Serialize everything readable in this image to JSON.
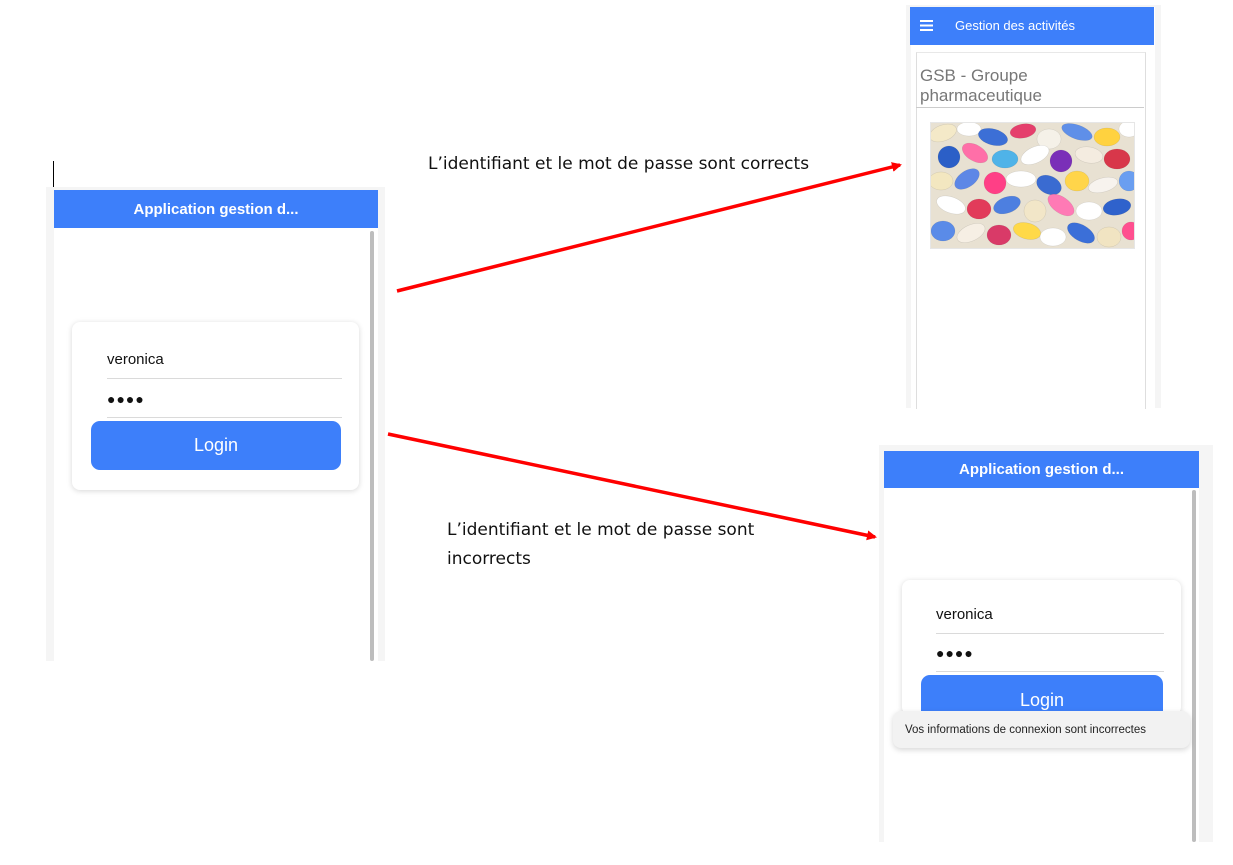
{
  "login_screen": {
    "app_title": "Application gestion d...",
    "username_value": "veronica",
    "password_mask": "●●●●",
    "login_label": "Login"
  },
  "success_screen": {
    "app_title": "Gestion des activités",
    "menu_icon": "hamburger-menu-icon",
    "heading": "GSB - Groupe pharmaceutique",
    "image": "pills-image"
  },
  "failure_screen": {
    "app_title": "Application gestion d...",
    "username_value": "veronica",
    "password_mask": "●●●●",
    "login_label": "Login",
    "toast_message": "Vos informations de connexion sont incorrectes"
  },
  "annotations": {
    "correct_label": "L’identifiant et le mot de passe sont corrects",
    "incorrect_label_line1": "L’identifiant et le mot de passe sont",
    "incorrect_label_line2": "incorrects"
  },
  "colors": {
    "app_blue": "#3d7ffa",
    "arrow_red": "#ff0000"
  }
}
